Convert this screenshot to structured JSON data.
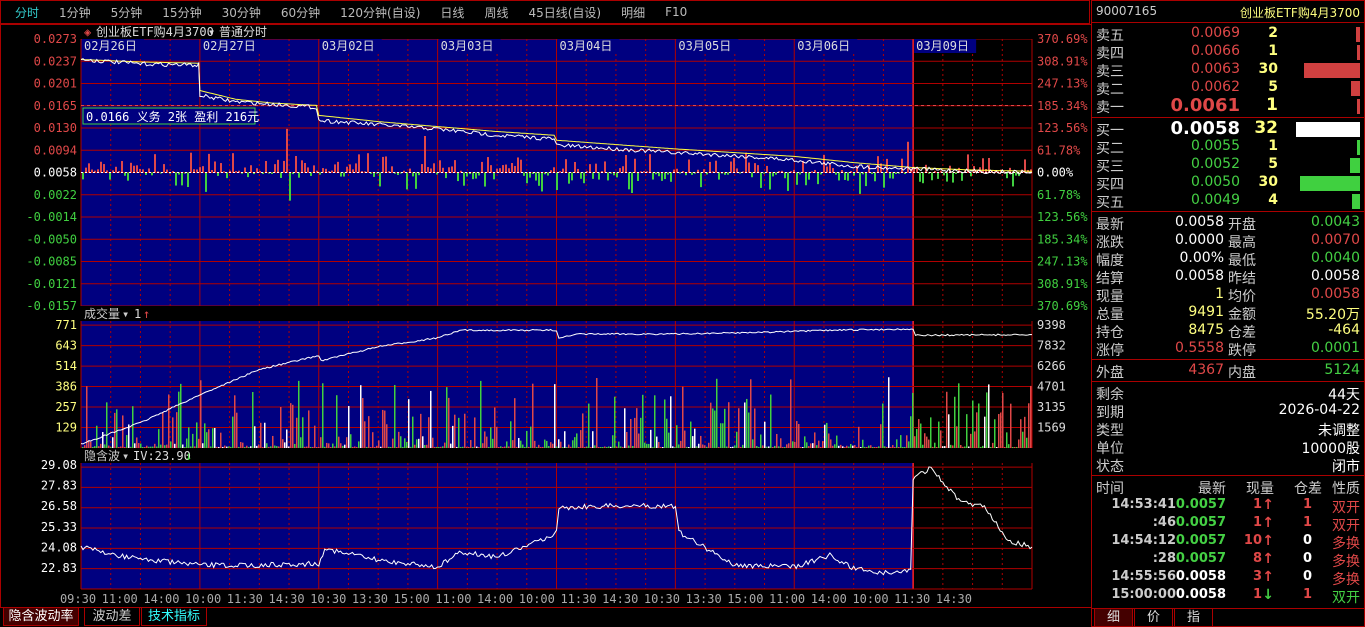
{
  "toolbar": {
    "tabs": [
      "分时",
      "1分钟",
      "5分钟",
      "15分钟",
      "30分钟",
      "60分钟",
      "120分钟(自设)",
      "日线",
      "周线",
      "45日线(自设)",
      "明细",
      "F10"
    ]
  },
  "chart_header": {
    "name": "创业板ETF购4月3700",
    "dropdown": "▾",
    "mode": "普通分时"
  },
  "dates": [
    "02月26日",
    "02月27日",
    "03月02日",
    "03月03日",
    "03月04日",
    "03月05日",
    "03月06日",
    "03月09日"
  ],
  "price_axis_left": [
    "0.0273",
    "0.0237",
    "0.0201",
    "0.0165",
    "0.0130",
    "0.0094",
    "0.0058",
    "0.0022",
    "-0.0014",
    "-0.0050",
    "-0.0085",
    "-0.0121",
    "-0.0157"
  ],
  "price_axis_right": [
    "370.69%",
    "308.91%",
    "247.13%",
    "185.34%",
    "123.56%",
    "61.78%",
    "0.00%",
    "61.78%",
    "123.56%",
    "185.34%",
    "247.13%",
    "308.91%",
    "370.69%"
  ],
  "info_box": "0.0166 义务 2张 盈利 216元",
  "volume_header": {
    "label": "成交量",
    "dropdown": "▾",
    "value": "1",
    "arrow": "↑"
  },
  "volume_axis_left": [
    "771",
    "643",
    "514",
    "386",
    "257",
    "129"
  ],
  "volume_axis_right": [
    "9398",
    "7832",
    "6266",
    "4701",
    "3135",
    "1569"
  ],
  "iv_header": {
    "label": "隐含波",
    "dropdown": "▾",
    "value": "IV:23.90",
    "arrow": "↓"
  },
  "iv_axis_left": [
    "29.08",
    "27.83",
    "26.58",
    "25.33",
    "24.08",
    "22.83"
  ],
  "time_axis": [
    "09:30",
    "11:00",
    "14:00",
    "10:00",
    "11:30",
    "14:30",
    "10:30",
    "13:30",
    "15:00",
    "11:00",
    "14:00",
    "10:00",
    "11:30",
    "14:30",
    "10:30",
    "13:30",
    "15:00",
    "11:00",
    "14:00",
    "10:00",
    "11:30",
    "14:30"
  ],
  "bottom_tabs": [
    "隐含波动率",
    "波动差",
    "技术指标"
  ],
  "chart_data": {
    "type": "line",
    "price": {
      "ylim": [
        -0.0157,
        0.0273
      ],
      "base": 0.0058,
      "line_x_days": [
        0,
        0.5,
        0.99,
        1.0,
        1.3,
        1.6,
        1.98,
        2.0,
        2.5,
        3.0,
        3.5,
        3.98,
        4.0,
        5.0,
        5.5,
        6.0,
        6.5,
        7.0,
        7.5,
        8.0
      ],
      "line": [
        0.024,
        0.0233,
        0.0231,
        0.0182,
        0.0172,
        0.0168,
        0.0163,
        0.0142,
        0.0135,
        0.0128,
        0.0118,
        0.0112,
        0.0102,
        0.009,
        0.0085,
        0.0078,
        0.0068,
        0.0064,
        0.006,
        0.0058
      ],
      "avg": [
        0.024,
        0.0236,
        0.0234,
        0.019,
        0.0176,
        0.017,
        0.0166,
        0.015,
        0.014,
        0.0132,
        0.0124,
        0.0118,
        0.011,
        0.0096,
        0.009,
        0.0084,
        0.0074,
        0.0066,
        0.0062,
        0.006
      ],
      "reference": 0.0166
    },
    "cumulative_volume": {
      "ylim": [
        0,
        9398
      ],
      "x_days": [
        0,
        0.5,
        1,
        1.5,
        2,
        2.02,
        2.5,
        3,
        3.2,
        4,
        4.02,
        4.2,
        5,
        6,
        6.3,
        7,
        7.02,
        8
      ],
      "values": [
        300,
        2000,
        4200,
        6200,
        7300,
        6900,
        8000,
        8700,
        9300,
        9300,
        8700,
        9000,
        9000,
        9200,
        9300,
        9398,
        8900,
        8950
      ]
    },
    "iv": {
      "ylim": [
        21.9,
        29.3
      ],
      "x_days": [
        0,
        0.3,
        0.6,
        1,
        1.5,
        2,
        2.05,
        2.5,
        3,
        3.2,
        3.5,
        3.8,
        4,
        4.02,
        4.5,
        5,
        5.03,
        5.5,
        6,
        6.3,
        6.5,
        6.8,
        6.98,
        7.0,
        7.15,
        7.4,
        7.6,
        7.8,
        8
      ],
      "values": [
        24.1,
        23.6,
        23.3,
        23.0,
        23.0,
        23.1,
        24.0,
        23.3,
        22.9,
        23.8,
        23.5,
        24.3,
        25.0,
        26.5,
        26.6,
        26.6,
        25.0,
        23.0,
        22.9,
        23.6,
        22.8,
        22.5,
        22.7,
        28.3,
        28.9,
        26.8,
        26.6,
        24.5,
        24.1
      ],
      "current": 23.9
    }
  },
  "quote": {
    "code": "90007165",
    "name": "创业板ETF购4月3700",
    "asks": [
      {
        "label": "卖五",
        "price": "0.0069",
        "vol": "2",
        "depth": 2
      },
      {
        "label": "卖四",
        "price": "0.0066",
        "vol": "1",
        "depth": 1
      },
      {
        "label": "卖三",
        "price": "0.0063",
        "vol": "30",
        "depth": 30
      },
      {
        "label": "卖二",
        "price": "0.0062",
        "vol": "5",
        "depth": 5
      },
      {
        "label": "卖一",
        "price": "0.0061",
        "vol": "1",
        "depth": 1
      }
    ],
    "bids": [
      {
        "label": "买一",
        "price": "0.0058",
        "vol": "32",
        "depth": 32
      },
      {
        "label": "买二",
        "price": "0.0055",
        "vol": "1",
        "depth": 1
      },
      {
        "label": "买三",
        "price": "0.0052",
        "vol": "5",
        "depth": 5
      },
      {
        "label": "买四",
        "price": "0.0050",
        "vol": "30",
        "depth": 30
      },
      {
        "label": "买五",
        "price": "0.0049",
        "vol": "4",
        "depth": 4
      }
    ],
    "stats": [
      {
        "l1": "最新",
        "v1": "0.0058",
        "c1": "white",
        "l2": "开盘",
        "v2": "0.0043",
        "c2": "green"
      },
      {
        "l1": "涨跌",
        "v1": "0.0000",
        "c1": "white",
        "l2": "最高",
        "v2": "0.0070",
        "c2": "red"
      },
      {
        "l1": "幅度",
        "v1": "0.00%",
        "c1": "white",
        "l2": "最低",
        "v2": "0.0040",
        "c2": "green"
      },
      {
        "l1": "结算",
        "v1": "0.0058",
        "c1": "white",
        "l2": "昨结",
        "v2": "0.0058",
        "c2": "white"
      },
      {
        "l1": "现量",
        "v1": "1",
        "c1": "yellow",
        "l2": "均价",
        "v2": "0.0058",
        "c2": "red"
      },
      {
        "l1": "总量",
        "v1": "9491",
        "c1": "yellow",
        "l2": "金额",
        "v2": "55.20万",
        "c2": "yellow"
      },
      {
        "l1": "持仓",
        "v1": "8475",
        "c1": "yellow",
        "l2": "仓差",
        "v2": "-464",
        "c2": "yellow"
      },
      {
        "l1": "涨停",
        "v1": "0.5558",
        "c1": "red",
        "l2": "跌停",
        "v2": "0.0001",
        "c2": "green"
      }
    ],
    "outer": {
      "l1": "外盘",
      "v1": "4367",
      "l2": "内盘",
      "v2": "5124"
    },
    "contract": [
      {
        "l": "剩余",
        "v": "44天"
      },
      {
        "l": "到期",
        "v": "2026-04-22"
      },
      {
        "l": "类型",
        "v": "未调整"
      },
      {
        "l": "单位",
        "v": "10000股"
      },
      {
        "l": "状态",
        "v": "闭市"
      }
    ],
    "trades_header": [
      "时间",
      "最新",
      "现量",
      "仓差",
      "性质"
    ],
    "trades": [
      {
        "t": "14:53:41",
        "p": "0.0057",
        "pc": "green",
        "q": "1",
        "a": "↑",
        "ac": "red",
        "oi": "1",
        "oic": "red",
        "n": "双开",
        "nc": "red"
      },
      {
        "t": ":46",
        "p": "0.0057",
        "pc": "green",
        "q": "1",
        "a": "↑",
        "ac": "red",
        "oi": "1",
        "oic": "red",
        "n": "双开",
        "nc": "red"
      },
      {
        "t": "14:54:12",
        "p": "0.0057",
        "pc": "green",
        "q": "10",
        "a": "↑",
        "ac": "red",
        "oi": "0",
        "oic": "white",
        "n": "多换",
        "nc": "red"
      },
      {
        "t": ":28",
        "p": "0.0057",
        "pc": "green",
        "q": "8",
        "a": "↑",
        "ac": "red",
        "oi": "0",
        "oic": "white",
        "n": "多换",
        "nc": "red"
      },
      {
        "t": "14:55:56",
        "p": "0.0058",
        "pc": "white",
        "q": "3",
        "a": "↑",
        "ac": "red",
        "oi": "0",
        "oic": "white",
        "n": "多换",
        "nc": "red"
      },
      {
        "t": "15:00:00",
        "p": "0.0058",
        "pc": "white",
        "q": "1",
        "a": "↓",
        "ac": "green",
        "oi": "1",
        "oic": "red",
        "n": "双开",
        "nc": "green"
      }
    ],
    "side_tabs": [
      "细",
      "价",
      "指"
    ]
  },
  "colors": {
    "panel_bg": "#000080",
    "grid": "#b00000",
    "up": "#e04848",
    "down": "#40d040"
  }
}
